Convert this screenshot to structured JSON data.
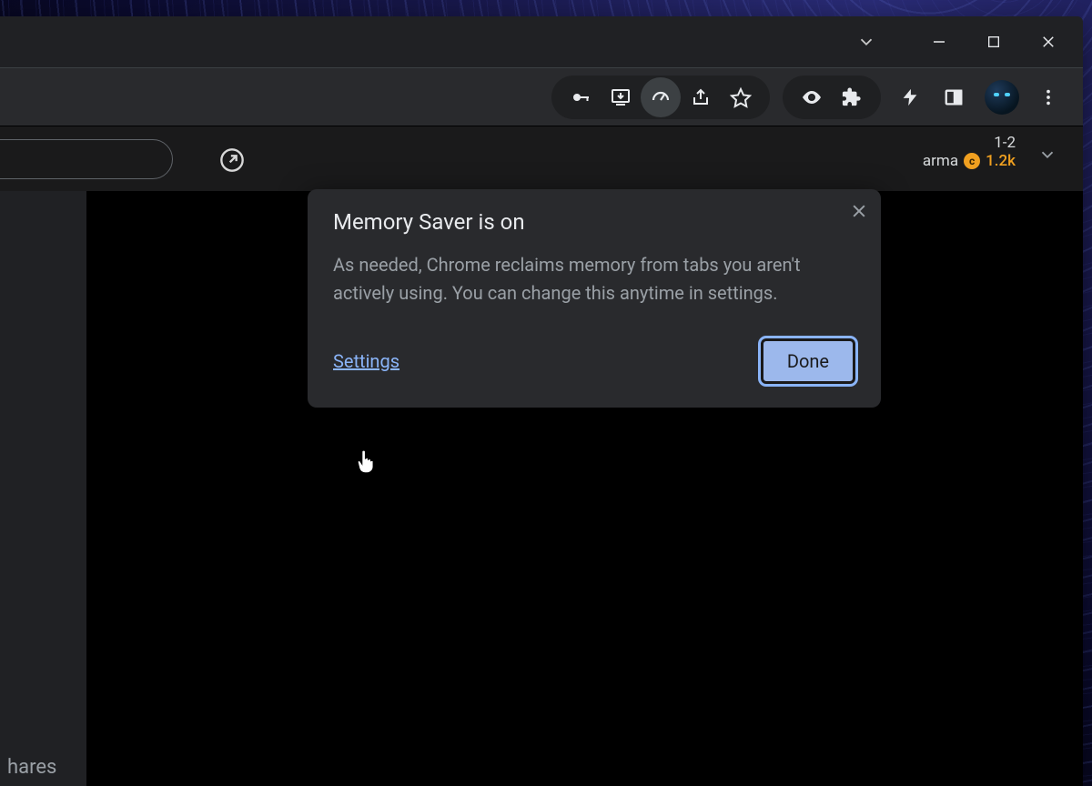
{
  "popup": {
    "title": "Memory Saver is on",
    "body": "As needed, Chrome reclaims memory from tabs you aren't actively using. You can change this anytime in settings.",
    "settings_label": "Settings",
    "done_label": "Done"
  },
  "page": {
    "header_right_top": "1-2",
    "header_right_label": "arma",
    "header_karma": "1.2k",
    "footer_fragment": "hares"
  },
  "colors": {
    "link": "#8ab4f8",
    "bubble_bg": "#292a2d",
    "page_bg": "#000000",
    "chrome_bg": "#202124"
  }
}
